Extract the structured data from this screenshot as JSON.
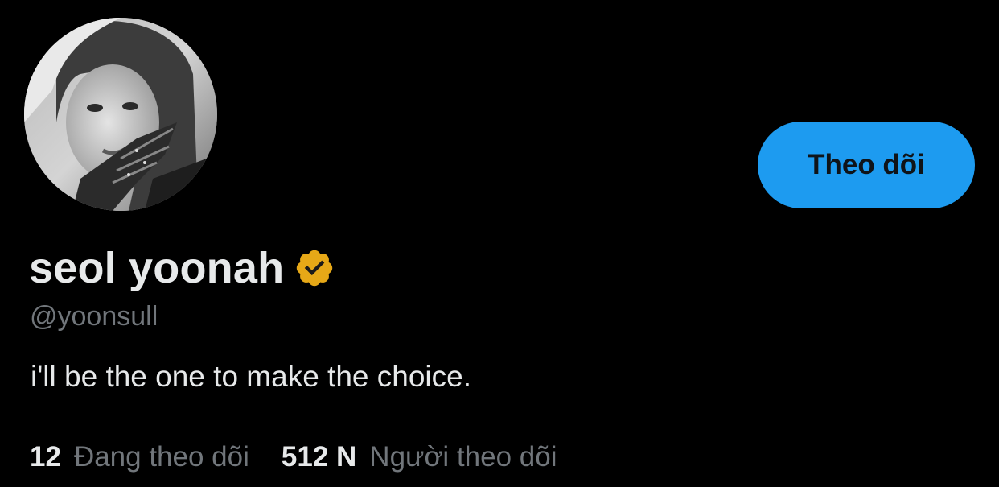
{
  "profile": {
    "avatar_icon": "profile-photo",
    "display_name": "seol yoonah",
    "verified_badge_color": "#e6a817",
    "handle": "@yoonsull",
    "bio": "i'll be the one to make the choice.",
    "follow_button_label": "Theo dõi",
    "following": {
      "count": "12",
      "label": "Đang theo dõi"
    },
    "followers": {
      "count": "512 N",
      "label": "Người theo dõi"
    }
  },
  "colors": {
    "background": "#000000",
    "accent": "#1d9bf0",
    "primary_text": "#e7e9ea",
    "secondary_text": "#71767b"
  }
}
